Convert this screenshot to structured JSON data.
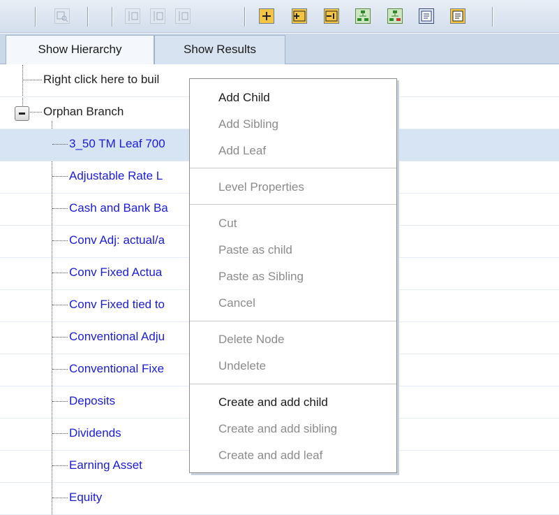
{
  "toolbar": {
    "buttons": [
      {
        "icon": "find-icon"
      },
      {
        "icon": "move-up-icon"
      },
      {
        "icon": "move-down-icon"
      },
      {
        "icon": "move-out-icon"
      },
      {
        "icon": "add-child-icon"
      },
      {
        "icon": "add-sibling-icon"
      },
      {
        "icon": "add-leaf-icon"
      },
      {
        "icon": "hierarchy-icon"
      },
      {
        "icon": "hierarchy-tree-icon"
      },
      {
        "icon": "properties-icon"
      },
      {
        "icon": "details-icon"
      }
    ]
  },
  "tabs": [
    {
      "label": "Show Hierarchy",
      "active": true
    },
    {
      "label": "Show Results",
      "active": false
    }
  ],
  "tree": {
    "root_label": "Right click here to build hierarchy",
    "root_visible": "Right click here to buil",
    "branch_label": "Orphan Branch",
    "leaves": [
      {
        "label": "3_50 TM Leaf 700"
      },
      {
        "label": "Adjustable Rate L"
      },
      {
        "label": "Cash and Bank Ba"
      },
      {
        "label": "Conv Adj: actual/a"
      },
      {
        "label": "Conv Fixed Actua"
      },
      {
        "label": "Conv Fixed tied to"
      },
      {
        "label": "Conventional Adju"
      },
      {
        "label": "Conventional Fixe"
      },
      {
        "label": "Deposits"
      },
      {
        "label": "Dividends"
      },
      {
        "label": "Earning Asset"
      },
      {
        "label": "Equity"
      }
    ]
  },
  "context_menu": {
    "groups": [
      [
        {
          "label": "Add Child",
          "enabled": true
        },
        {
          "label": "Add Sibling",
          "enabled": false
        },
        {
          "label": "Add Leaf",
          "enabled": false
        }
      ],
      [
        {
          "label": "Level Properties",
          "enabled": false
        }
      ],
      [
        {
          "label": "Cut",
          "enabled": false
        },
        {
          "label": "Paste as child",
          "enabled": false
        },
        {
          "label": "Paste as Sibling",
          "enabled": false
        },
        {
          "label": "Cancel",
          "enabled": false
        }
      ],
      [
        {
          "label": "Delete Node",
          "enabled": false
        },
        {
          "label": "Undelete",
          "enabled": false
        }
      ],
      [
        {
          "label": "Create and add child",
          "enabled": true
        },
        {
          "label": "Create and add sibling",
          "enabled": false
        },
        {
          "label": "Create and add leaf",
          "enabled": false
        }
      ]
    ]
  }
}
